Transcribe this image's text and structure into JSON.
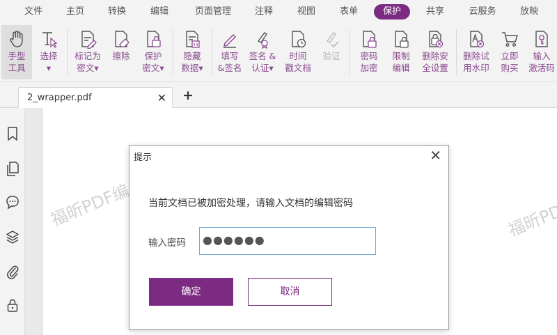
{
  "menu": {
    "items": [
      "文件",
      "主页",
      "转换",
      "编辑",
      "页面管理",
      "注释",
      "视图",
      "表单",
      "保护",
      "共享",
      "云服务",
      "放映"
    ],
    "active": "保护"
  },
  "ribbon": {
    "buttons": [
      {
        "label": "手型\n工具",
        "icon": "hand-icon"
      },
      {
        "label": "选择\n▾",
        "icon": "select-text-icon"
      },
      {
        "label": "标记为\n密文▾",
        "icon": "mark-redaction-icon"
      },
      {
        "label": "擦除",
        "icon": "eraser-icon"
      },
      {
        "label": "保护\n密文▾",
        "icon": "protect-redaction-icon"
      },
      {
        "label": "隐藏\n数据▾",
        "icon": "hide-data-icon"
      },
      {
        "label": "填写\n&签名",
        "icon": "fill-sign-icon"
      },
      {
        "label": "签名 &\n认证▾",
        "icon": "sign-certify-icon"
      },
      {
        "label": "时间\n戳文档",
        "icon": "timestamp-icon"
      },
      {
        "label": "验证",
        "icon": "validate-icon"
      },
      {
        "label": "密码\n加密",
        "icon": "password-encrypt-icon"
      },
      {
        "label": "限制\n编辑",
        "icon": "restrict-edit-icon"
      },
      {
        "label": "删除安\n全设置",
        "icon": "remove-security-icon"
      },
      {
        "label": "删除试\n用水印",
        "icon": "remove-watermark-icon"
      },
      {
        "label": "立即\n购买",
        "icon": "cart-icon"
      },
      {
        "label": "输入\n激活码",
        "icon": "activation-code-icon"
      }
    ]
  },
  "tab": {
    "name": "2_wrapper.pdf",
    "close": "✕",
    "add": "+"
  },
  "watermark": "福昕PDF编",
  "dialog": {
    "title": "提示",
    "close": "✕",
    "message": "当前文档已被加密处理，请输入文档的编辑密码",
    "password_label": "输入密码",
    "password_value": "●●●●●●",
    "ok": "确定",
    "cancel": "取消"
  },
  "colors": {
    "accent": "#7b2c82",
    "icon_purple": "#8a4a8f",
    "input_border": "#6fa6d6"
  }
}
